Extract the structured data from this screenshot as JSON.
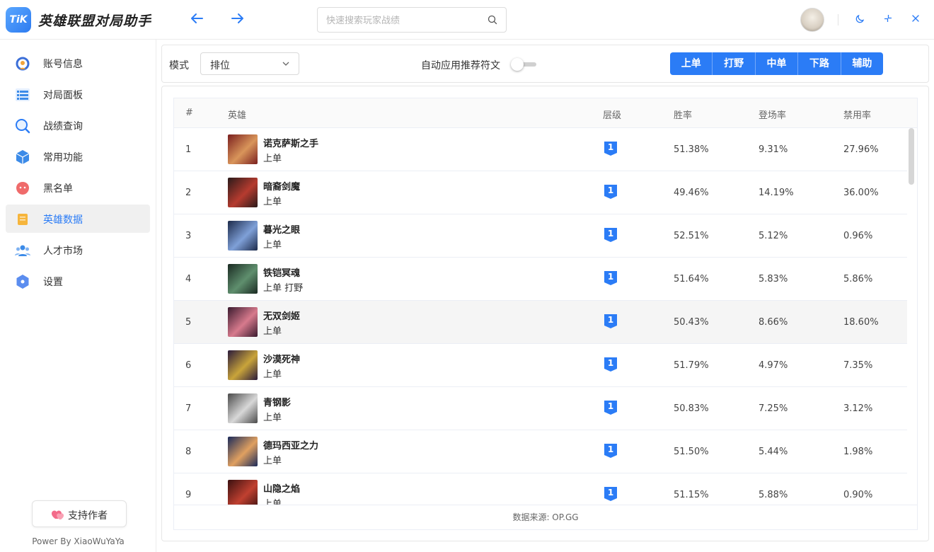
{
  "app": {
    "logo_text": "TiK",
    "title": "英雄联盟对局助手"
  },
  "search": {
    "placeholder": "快速搜索玩家战绩"
  },
  "colors": {
    "accent": "#2b7cf6",
    "tier_badge": "#2b7cf6"
  },
  "sidebar": {
    "items": [
      {
        "label": "账号信息",
        "icon": "account-icon"
      },
      {
        "label": "对局面板",
        "icon": "match-panel-icon"
      },
      {
        "label": "战绩查询",
        "icon": "search-record-icon"
      },
      {
        "label": "常用功能",
        "icon": "cube-icon"
      },
      {
        "label": "黑名单",
        "icon": "blacklist-icon"
      },
      {
        "label": "英雄数据",
        "icon": "hero-data-icon",
        "active": true
      },
      {
        "label": "人才市场",
        "icon": "people-icon"
      },
      {
        "label": "设置",
        "icon": "settings-icon"
      }
    ],
    "support_label": "支持作者",
    "powered_by": "Power By XiaoWuYaYa"
  },
  "filter": {
    "mode_label": "模式",
    "mode_value": "排位",
    "auto_rune_label": "自动应用推荐符文",
    "auto_rune_enabled": false,
    "lanes": [
      "上单",
      "打野",
      "中单",
      "下路",
      "辅助"
    ],
    "selected_lane": "上单"
  },
  "table": {
    "headers": {
      "num": "#",
      "hero": "英雄",
      "tier": "层级",
      "winrate": "胜率",
      "pickrate": "登场率",
      "banrate": "禁用率"
    },
    "rows": [
      {
        "num": "1",
        "name": "诺克萨斯之手",
        "pos": "上单",
        "tier": "1",
        "winrate": "51.38%",
        "pickrate": "9.31%",
        "banrate": "27.96%"
      },
      {
        "num": "2",
        "name": "暗裔剑魔",
        "pos": "上单",
        "tier": "1",
        "winrate": "49.46%",
        "pickrate": "14.19%",
        "banrate": "36.00%"
      },
      {
        "num": "3",
        "name": "暮光之眼",
        "pos": "上单",
        "tier": "1",
        "winrate": "52.51%",
        "pickrate": "5.12%",
        "banrate": "0.96%"
      },
      {
        "num": "4",
        "name": "铁铠冥魂",
        "pos": "上单 打野",
        "tier": "1",
        "winrate": "51.64%",
        "pickrate": "5.83%",
        "banrate": "5.86%"
      },
      {
        "num": "5",
        "name": "无双剑姬",
        "pos": "上单",
        "tier": "1",
        "winrate": "50.43%",
        "pickrate": "8.66%",
        "banrate": "18.60%"
      },
      {
        "num": "6",
        "name": "沙漠死神",
        "pos": "上单",
        "tier": "1",
        "winrate": "51.79%",
        "pickrate": "4.97%",
        "banrate": "7.35%"
      },
      {
        "num": "7",
        "name": "青钢影",
        "pos": "上单",
        "tier": "1",
        "winrate": "50.83%",
        "pickrate": "7.25%",
        "banrate": "3.12%"
      },
      {
        "num": "8",
        "name": "德玛西亚之力",
        "pos": "上单",
        "tier": "1",
        "winrate": "51.50%",
        "pickrate": "5.44%",
        "banrate": "1.98%"
      },
      {
        "num": "9",
        "name": "山隐之焰",
        "pos": "上单",
        "tier": "1",
        "winrate": "51.15%",
        "pickrate": "5.88%",
        "banrate": "0.90%"
      }
    ],
    "source": "数据来源:   OP.GG"
  }
}
